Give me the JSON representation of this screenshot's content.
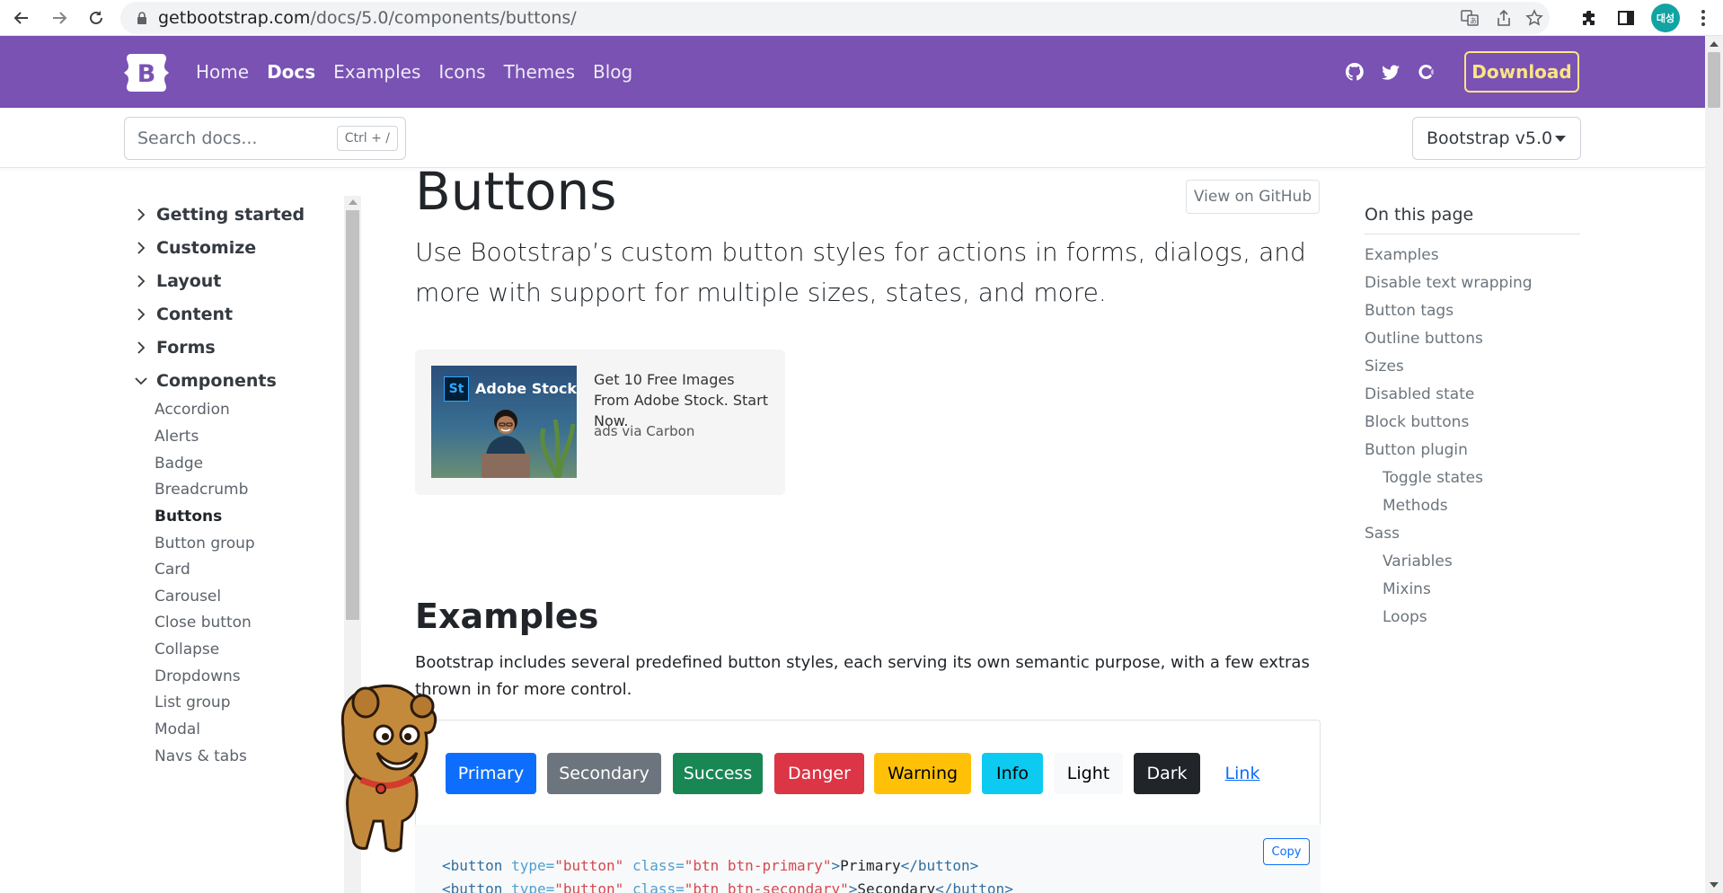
{
  "browser": {
    "url_host": "getbootstrap.com",
    "url_path": "/docs/5.0/components/buttons/",
    "profile_label": "대성"
  },
  "navbar": {
    "logo_letter": "B",
    "links": [
      "Home",
      "Docs",
      "Examples",
      "Icons",
      "Themes",
      "Blog"
    ],
    "active_link": "Docs",
    "download_label": "Download",
    "brand_color": "#7952b3",
    "accent_color": "#ffe484",
    "social_icons": [
      "github-icon",
      "twitter-icon",
      "opencollective-icon"
    ]
  },
  "subnav": {
    "search_placeholder": "Search docs...",
    "search_shortcut": "Ctrl + /",
    "version_label": "Bootstrap v5.0"
  },
  "sidebar": {
    "groups": [
      "Getting started",
      "Customize",
      "Layout",
      "Content",
      "Forms",
      "Components"
    ],
    "expanded_group": "Components",
    "items": [
      "Accordion",
      "Alerts",
      "Badge",
      "Breadcrumb",
      "Buttons",
      "Button group",
      "Card",
      "Carousel",
      "Close button",
      "Collapse",
      "Dropdowns",
      "List group",
      "Modal",
      "Navs & tabs"
    ],
    "active_item": "Buttons"
  },
  "main": {
    "title": "Buttons",
    "github_button": "View on GitHub",
    "lead": "Use Bootstrap’s custom button styles for actions in forms, dialogs, and more with support for multiple sizes, states, and more.",
    "ad": {
      "brand": "Adobe Stock",
      "brand_badge": "St",
      "text": "Get 10 Free Images From Adobe Stock. Start Now.",
      "via": "ads via Carbon"
    },
    "examples_heading": "Examples",
    "examples_text": "Bootstrap includes several predefined button styles, each serving its own semantic purpose, with a few extras thrown in for more control.",
    "buttons": [
      {
        "label": "Primary",
        "color": "#0d6efd",
        "text": "#ffffff"
      },
      {
        "label": "Secondary",
        "color": "#6c757d",
        "text": "#ffffff"
      },
      {
        "label": "Success",
        "color": "#198754",
        "text": "#ffffff"
      },
      {
        "label": "Danger",
        "color": "#dc3545",
        "text": "#ffffff"
      },
      {
        "label": "Warning",
        "color": "#ffc107",
        "text": "#000000"
      },
      {
        "label": "Info",
        "color": "#0dcaf0",
        "text": "#000000"
      },
      {
        "label": "Light",
        "color": "#f8f9fa",
        "text": "#000000"
      },
      {
        "label": "Dark",
        "color": "#212529",
        "text": "#ffffff"
      },
      {
        "label": "Link",
        "color": "transparent",
        "text": "#0d6efd"
      }
    ],
    "copy_label": "Copy",
    "code": {
      "line1": {
        "open": "<button",
        "type_attr": "type=",
        "type_val": "\"button\"",
        "class_attr": "class=",
        "class_val": "\"btn btn-primary\"",
        "content": "Primary",
        "close": "</button>"
      },
      "line2": {
        "open": "<button",
        "type_attr": "type=",
        "type_val": "\"button\"",
        "class_attr": "class=",
        "class_val": "\"btn btn-secondary\"",
        "content": "Secondary",
        "close": "</button>"
      }
    }
  },
  "toc": {
    "title": "On this page",
    "items": [
      {
        "label": "Examples",
        "level": 1
      },
      {
        "label": "Disable text wrapping",
        "level": 1
      },
      {
        "label": "Button tags",
        "level": 1
      },
      {
        "label": "Outline buttons",
        "level": 1
      },
      {
        "label": "Sizes",
        "level": 1
      },
      {
        "label": "Disabled state",
        "level": 1
      },
      {
        "label": "Block buttons",
        "level": 1
      },
      {
        "label": "Button plugin",
        "level": 1
      },
      {
        "label": "Toggle states",
        "level": 2
      },
      {
        "label": "Methods",
        "level": 2
      },
      {
        "label": "Sass",
        "level": 1
      },
      {
        "label": "Variables",
        "level": 2
      },
      {
        "label": "Mixins",
        "level": 2
      },
      {
        "label": "Loops",
        "level": 2
      }
    ]
  }
}
